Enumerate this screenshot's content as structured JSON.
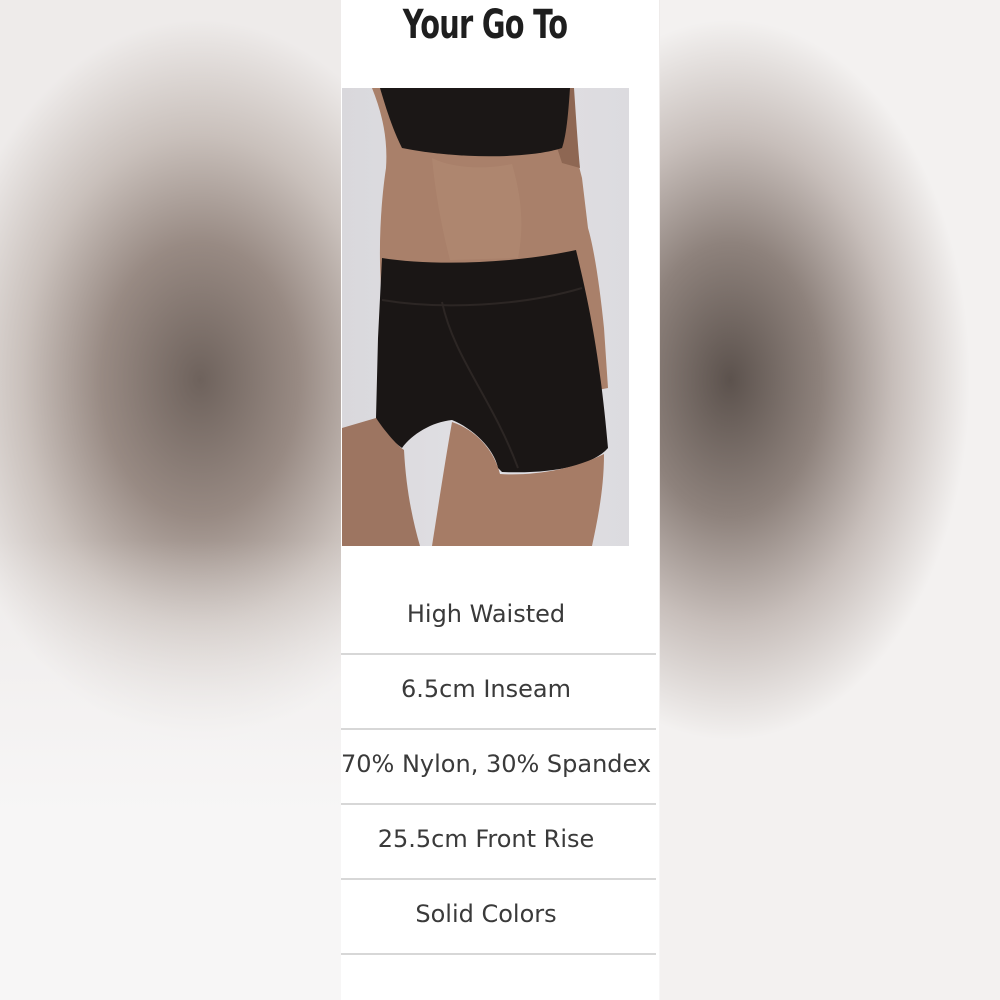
{
  "title": "Your Go To",
  "product_image": {
    "icon": "shorts-product-photo",
    "description_colors": {
      "background": "#dedde1",
      "garment": "#1a1615",
      "skin": "#a57a63"
    }
  },
  "specs": [
    {
      "label": "High Waisted"
    },
    {
      "label": "6.5cm Inseam"
    },
    {
      "label": "70% Nylon, 30% Spandex"
    },
    {
      "label": "25.5cm Front Rise"
    },
    {
      "label": "Solid Colors"
    }
  ]
}
